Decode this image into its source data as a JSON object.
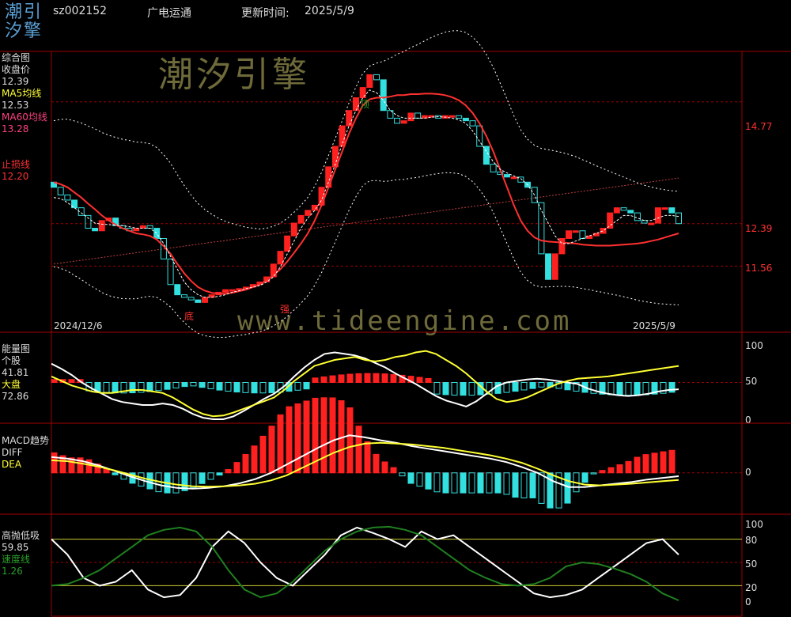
{
  "header": {
    "logo_top": "潮引",
    "logo_bottom": "汐擎",
    "code": "sz002152",
    "name": "广电运通",
    "update_label": "更新时间:",
    "update_date": "2025/5/9"
  },
  "watermark": {
    "brand": "潮汐引擎",
    "url": "www.tideengine.com"
  },
  "colors": {
    "bg": "#000000",
    "up": "#ff2020",
    "down": "#33e0e0",
    "ma5": "#ffffff",
    "ma60": "#ff3030",
    "grid": "#a00000",
    "yellow": "#ffff33",
    "green": "#208020"
  },
  "panels": {
    "main": {
      "title": "综合图",
      "close_label": "收盘价",
      "close_value": "12.39",
      "ma5_label": "MA5均线",
      "ma5_value": "12.53",
      "ma60_label": "MA60均线",
      "ma60_value": "13.28",
      "stop_label": "止损线",
      "stop_value": "12.20",
      "date_start": "2024/12/6",
      "date_end": "2025/5/9",
      "mark_bottom": "底",
      "mark_strong": "强",
      "mark_top": "顶",
      "ticks": [
        "14.77",
        "12.39",
        "11.56"
      ]
    },
    "energy": {
      "title": "能量图",
      "stock_label": "个股",
      "stock_value": "41.81",
      "market_label": "大盘",
      "market_value": "72.86",
      "ticks": [
        "100",
        "50",
        "0"
      ]
    },
    "macd": {
      "title": "MACD趋势",
      "diff_label": "DIFF",
      "dea_label": "DEA",
      "ticks": [
        "0"
      ]
    },
    "kdj": {
      "title": "高抛低吸",
      "value": "59.85",
      "speed_label": "速度线",
      "speed_value": "1.26",
      "ticks": [
        "100",
        "80",
        "50",
        "20",
        "0"
      ]
    }
  },
  "chart_data": [
    {
      "type": "candlestick",
      "title": "综合图",
      "x": [
        "2024/12/6",
        "2025/5/9"
      ],
      "ylim": [
        10.5,
        15.6
      ],
      "yticks": [
        14.77,
        12.39,
        11.56
      ],
      "close": [
        13.1,
        12.95,
        12.85,
        12.7,
        12.55,
        12.3,
        12.25,
        12.45,
        12.5,
        12.35,
        12.3,
        12.25,
        12.3,
        12.35,
        12.3,
        12.1,
        11.7,
        11.2,
        11.0,
        10.95,
        10.9,
        10.85,
        10.95,
        11.0,
        11.05,
        11.1,
        11.1,
        11.12,
        11.15,
        11.2,
        11.25,
        11.35,
        11.6,
        11.85,
        12.15,
        12.4,
        12.55,
        12.65,
        12.75,
        13.1,
        13.5,
        13.9,
        14.3,
        14.6,
        14.85,
        15.05,
        15.3,
        15.2,
        14.6,
        14.45,
        14.35,
        14.4,
        14.55,
        14.45,
        14.5,
        14.5,
        14.45,
        14.5,
        14.5,
        14.45,
        14.4,
        14.3,
        13.9,
        13.55,
        13.4,
        13.35,
        13.3,
        13.3,
        13.2,
        13.1,
        12.8,
        11.8,
        11.3,
        11.8,
        12.1,
        12.25,
        12.25,
        12.1,
        12.15,
        12.2,
        12.3,
        12.6,
        12.7,
        12.65,
        12.6,
        12.45,
        12.4,
        12.4,
        12.7,
        12.7,
        12.6,
        12.39
      ],
      "ma5": [
        12.9,
        12.88,
        12.8,
        12.7,
        12.6,
        12.5,
        12.4,
        12.38,
        12.37,
        12.36,
        12.35,
        12.33,
        12.3,
        12.3,
        12.3,
        12.2,
        12.0,
        11.75,
        11.5,
        11.25,
        11.1,
        11.0,
        10.95,
        10.95,
        10.97,
        11.0,
        11.05,
        11.08,
        11.12,
        11.15,
        11.18,
        11.25,
        11.35,
        11.55,
        11.8,
        12.05,
        12.3,
        12.5,
        12.65,
        12.85,
        13.2,
        13.55,
        13.95,
        14.3,
        14.6,
        14.85,
        15.0,
        14.95,
        14.8,
        14.6,
        14.5,
        14.45,
        14.45,
        14.45,
        14.45,
        14.47,
        14.48,
        14.47,
        14.45,
        14.42,
        14.35,
        14.2,
        14.0,
        13.8,
        13.6,
        13.45,
        13.38,
        13.32,
        13.27,
        13.15,
        12.95,
        12.65,
        12.4,
        12.15,
        12.0,
        12.0,
        12.05,
        12.1,
        12.15,
        12.2,
        12.25,
        12.35,
        12.45,
        12.55,
        12.55,
        12.5,
        12.45,
        12.45,
        12.5,
        12.55,
        12.55,
        12.53
      ],
      "ma60": [
        13.2,
        13.16,
        13.1,
        13.0,
        12.9,
        12.78,
        12.67,
        12.55,
        12.45,
        12.37,
        12.3,
        12.25,
        12.2,
        12.18,
        12.15,
        12.08,
        11.95,
        11.8,
        11.6,
        11.42,
        11.27,
        11.15,
        11.08,
        11.04,
        11.02,
        11.02,
        11.04,
        11.07,
        11.1,
        11.15,
        11.2,
        11.28,
        11.38,
        11.5,
        11.65,
        11.82,
        12.0,
        12.2,
        12.45,
        12.75,
        13.1,
        13.45,
        13.8,
        14.15,
        14.45,
        14.7,
        14.82,
        14.85,
        14.85,
        14.87,
        14.9,
        14.9,
        14.92,
        14.92,
        14.93,
        14.93,
        14.92,
        14.9,
        14.86,
        14.8,
        14.7,
        14.55,
        14.35,
        14.1,
        13.8,
        13.45,
        13.1,
        12.75,
        12.45,
        12.25,
        12.12,
        12.06,
        12.04,
        12.03,
        12.02,
        12.01,
        12.0,
        11.98,
        11.97,
        11.96,
        11.96,
        11.96,
        11.97,
        11.98,
        11.99,
        12.0,
        12.02,
        12.05,
        12.08,
        12.12,
        12.16,
        12.2
      ]
    },
    {
      "type": "line",
      "title": "能量图",
      "ylim": [
        0,
        100
      ],
      "yticks": [
        100,
        50,
        0
      ],
      "series": [
        {
          "name": "个股",
          "values": [
            75,
            68,
            60,
            50,
            42,
            35,
            28,
            24,
            22,
            20,
            20,
            22,
            20,
            15,
            8,
            3,
            1,
            1,
            5,
            12,
            20,
            28,
            35,
            45,
            58,
            70,
            80,
            88,
            90,
            88,
            86,
            82,
            76,
            70,
            62,
            55,
            48,
            40,
            32,
            26,
            22,
            18,
            25,
            35,
            45,
            50,
            52,
            54,
            55,
            54,
            52,
            50,
            48,
            42,
            38,
            35,
            33,
            32,
            33,
            35,
            38,
            40,
            41
          ]
        },
        {
          "name": "大盘",
          "values": [
            58,
            52,
            46,
            42,
            38,
            36,
            36,
            38,
            40,
            40,
            38,
            36,
            30,
            22,
            14,
            8,
            5,
            6,
            10,
            15,
            20,
            25,
            30,
            40,
            52,
            62,
            72,
            76,
            80,
            82,
            84,
            80,
            78,
            80,
            84,
            86,
            90,
            92,
            88,
            80,
            72,
            62,
            50,
            38,
            28,
            24,
            26,
            30,
            36,
            42,
            48,
            52,
            55,
            56,
            57,
            58,
            60,
            62,
            64,
            66,
            68,
            70,
            72
          ]
        }
      ]
    },
    {
      "type": "line",
      "title": "MACD趋势",
      "ylim": [
        -0.8,
        1.0
      ],
      "yticks": [
        0
      ],
      "series": [
        {
          "name": "DIFF",
          "values": [
            0.38,
            0.34,
            0.28,
            0.18,
            0.05,
            -0.08,
            -0.2,
            -0.3,
            -0.36,
            -0.38,
            -0.36,
            -0.32,
            -0.25,
            -0.15,
            0.0,
            0.2,
            0.4,
            0.6,
            0.78,
            0.9,
            0.85,
            0.78,
            0.72,
            0.64,
            0.58,
            0.52,
            0.46,
            0.4,
            0.34,
            0.26,
            0.14,
            0.0,
            -0.2,
            -0.34,
            -0.34,
            -0.3,
            -0.26,
            -0.22,
            -0.16,
            -0.12,
            -0.08
          ]
        },
        {
          "name": "DEA",
          "values": [
            0.3,
            0.28,
            0.22,
            0.15,
            0.06,
            -0.04,
            -0.14,
            -0.22,
            -0.28,
            -0.32,
            -0.33,
            -0.32,
            -0.3,
            -0.26,
            -0.18,
            -0.06,
            0.12,
            0.3,
            0.48,
            0.62,
            0.7,
            0.72,
            0.7,
            0.68,
            0.64,
            0.6,
            0.54,
            0.48,
            0.42,
            0.34,
            0.24,
            0.1,
            -0.06,
            -0.2,
            -0.28,
            -0.3,
            -0.28,
            -0.26,
            -0.23,
            -0.2,
            -0.17
          ]
        }
      ]
    },
    {
      "type": "line",
      "title": "高抛低吸",
      "ylim": [
        0,
        100
      ],
      "yticks": [
        100,
        80,
        50,
        20,
        0
      ],
      "series": [
        {
          "name": "高抛低吸",
          "values": [
            80,
            60,
            30,
            20,
            25,
            40,
            15,
            5,
            8,
            30,
            70,
            90,
            75,
            50,
            30,
            20,
            40,
            60,
            85,
            95,
            88,
            80,
            70,
            90,
            80,
            85,
            70,
            55,
            40,
            25,
            10,
            5,
            8,
            15,
            30,
            45,
            60,
            75,
            80,
            60
          ]
        },
        {
          "name": "速度线",
          "values": [
            20,
            22,
            30,
            40,
            55,
            70,
            85,
            92,
            95,
            90,
            70,
            40,
            15,
            5,
            10,
            25,
            45,
            65,
            80,
            90,
            95,
            96,
            92,
            85,
            70,
            55,
            40,
            30,
            22,
            20,
            22,
            30,
            45,
            50,
            48,
            42,
            35,
            25,
            10,
            1
          ]
        }
      ]
    }
  ]
}
